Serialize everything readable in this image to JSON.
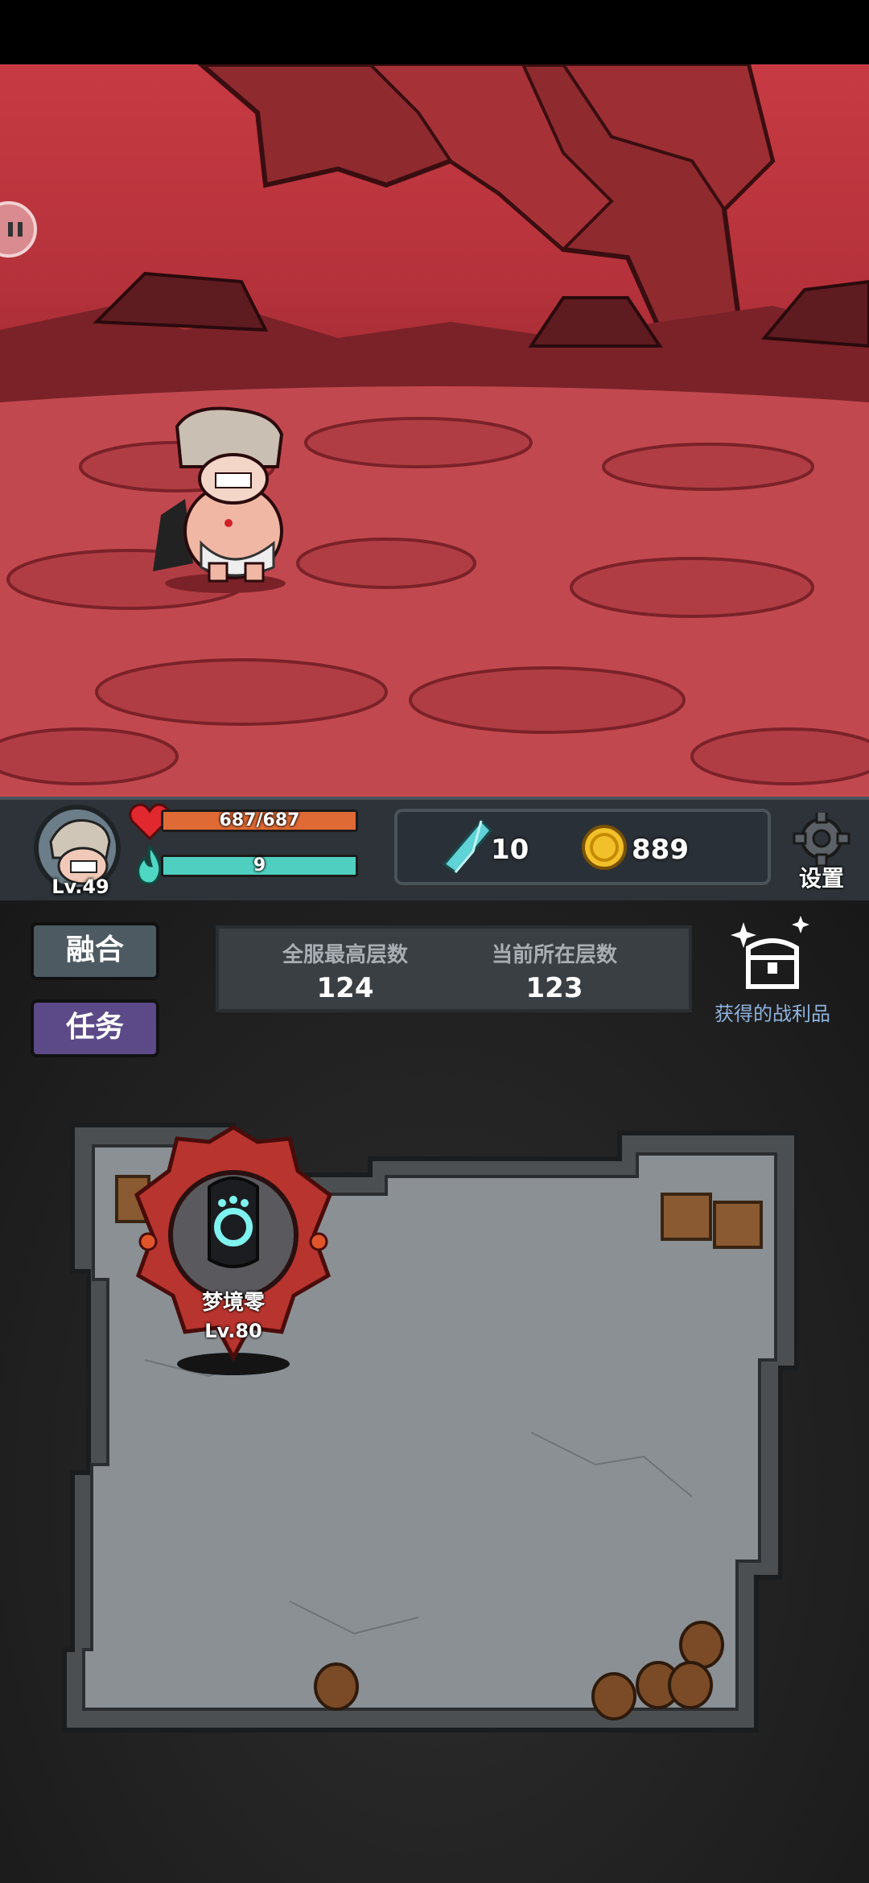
{
  "player": {
    "level_label": "Lv.49",
    "hp_text": "687/687",
    "hp_fraction": 1.0,
    "mana_text": "9",
    "mana_fraction": 1.0
  },
  "currency": {
    "gems": "10",
    "coins": "889"
  },
  "settings": {
    "label": "设置"
  },
  "buttons": {
    "fusion": "融合",
    "quest": "任务"
  },
  "floor": {
    "server_max_label": "全服最高层数",
    "server_max_value": "124",
    "current_label": "当前所在层数",
    "current_value": "123"
  },
  "loot": {
    "label": "获得的战利品"
  },
  "boss": {
    "name": "梦境零",
    "level": "Lv.80"
  },
  "icons": {
    "pause": "pause-icon",
    "heart": "heart-icon",
    "mana": "mana-flame-icon",
    "gem": "crystal-icon",
    "coin": "coin-icon",
    "settings": "gear-icon",
    "loot": "treasure-chest-icon"
  },
  "colors": {
    "hp": "#e06a35",
    "mana": "#4fcfc0",
    "fusion_button": "#4e5a62",
    "quest_button": "#5c4a88",
    "loot_text": "#8fb3df"
  }
}
